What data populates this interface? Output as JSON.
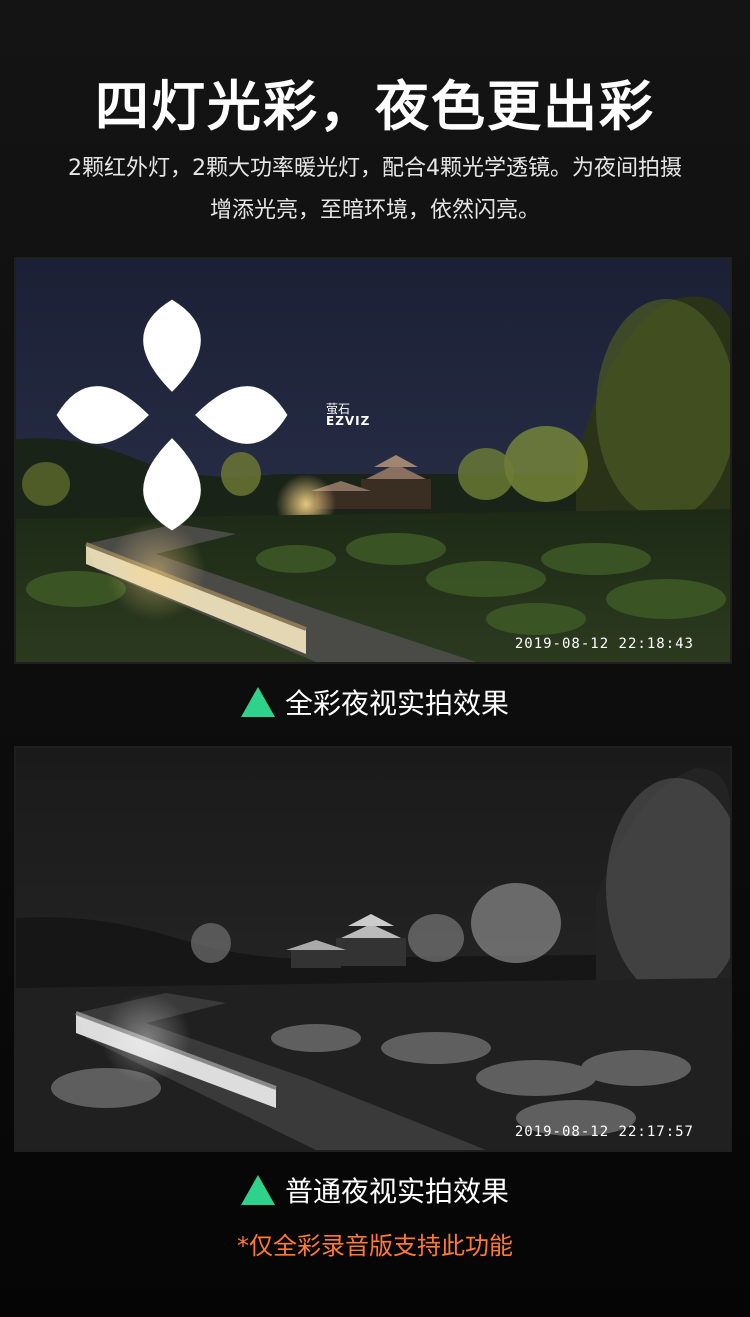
{
  "header": {
    "headline": "四灯光彩，夜色更出彩",
    "subtitle_line1": "2颗红外灯，2颗大功率暖光灯，配合4颗光学透镜。为夜间拍摄",
    "subtitle_line2": "增添光亮，至暗环境，依然闪亮。"
  },
  "logo": {
    "cn": "萤石",
    "en": "EZVIZ"
  },
  "photos": {
    "color": {
      "timestamp": "2019-08-12 22:18:43",
      "caption": "全彩夜视实拍效果"
    },
    "mono": {
      "timestamp": "2019-08-12 22:17:57",
      "caption": "普通夜视实拍效果"
    }
  },
  "note": "*仅全彩录音版支持此功能",
  "colors": {
    "accent_triangle": "#2fd28a",
    "note": "#ff7a33"
  },
  "icons": [
    "triangle-up-icon",
    "ezviz-logo-icon"
  ]
}
